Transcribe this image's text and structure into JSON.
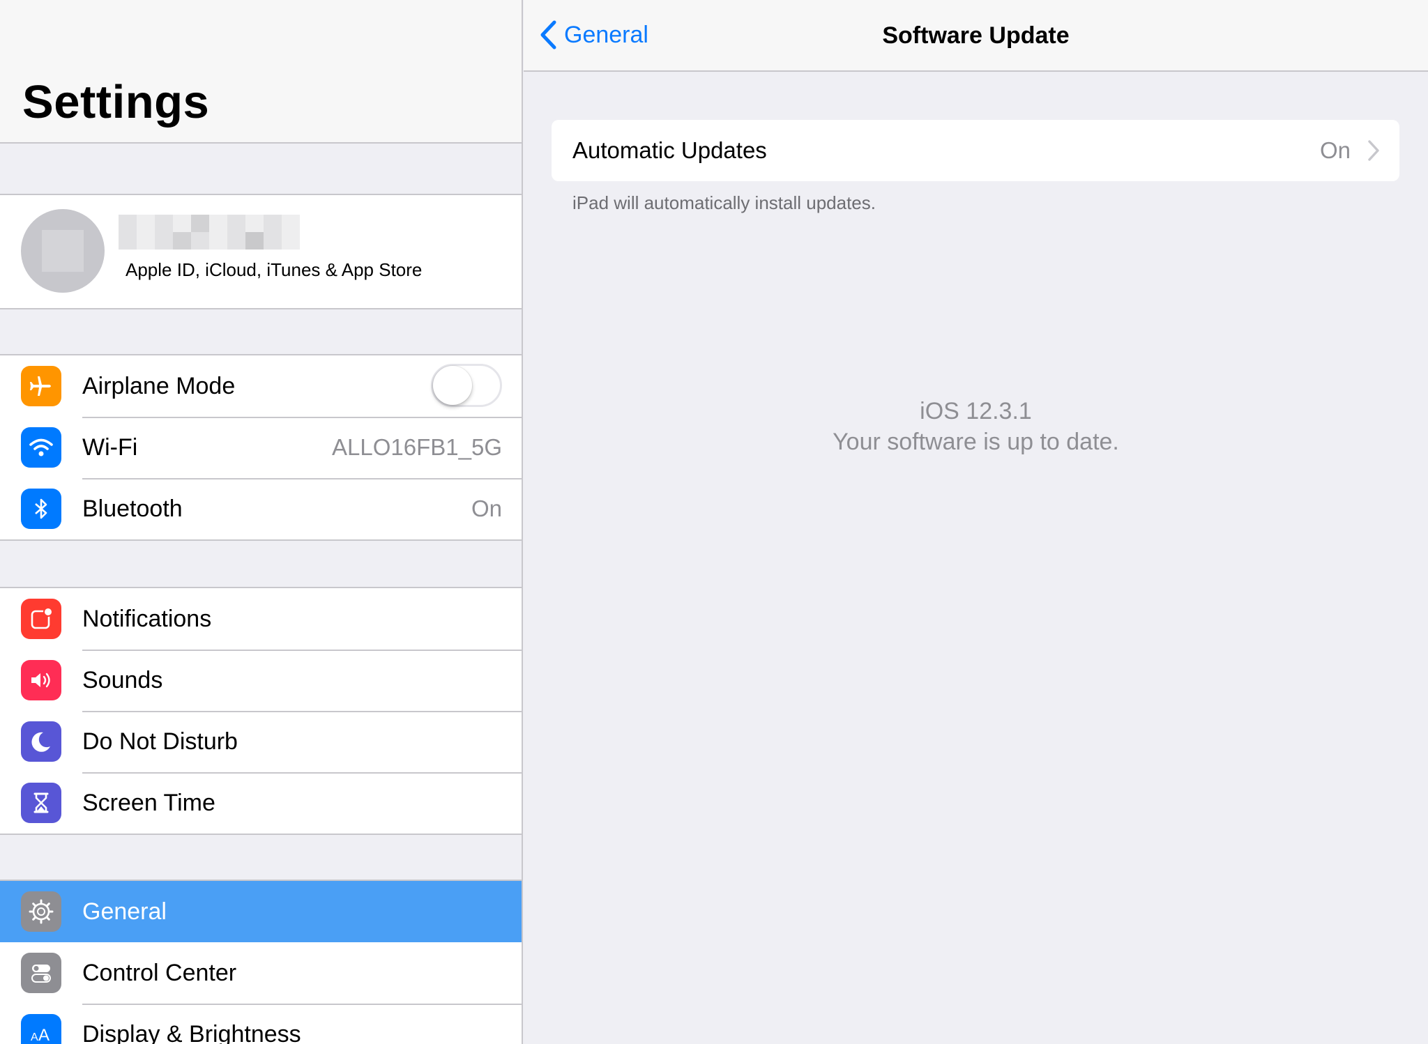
{
  "master": {
    "title": "Settings",
    "profile": {
      "subtitle": "Apple ID, iCloud, iTunes & App Store"
    },
    "connectivity": [
      {
        "label": "Airplane Mode",
        "icon": "airplane-icon",
        "color": "#ff9500",
        "toggle_on": false
      },
      {
        "label": "Wi-Fi",
        "icon": "wifi-icon",
        "color": "#007aff",
        "value": "ALLO16FB1_5G"
      },
      {
        "label": "Bluetooth",
        "icon": "bluetooth-icon",
        "color": "#007aff",
        "value": "On"
      }
    ],
    "alerts": [
      {
        "label": "Notifications",
        "icon": "notifications-icon",
        "color": "#ff3b30"
      },
      {
        "label": "Sounds",
        "icon": "sounds-icon",
        "color": "#ff2d55"
      },
      {
        "label": "Do Not Disturb",
        "icon": "moon-icon",
        "color": "#5856d6"
      },
      {
        "label": "Screen Time",
        "icon": "hourglass-icon",
        "color": "#5856d6"
      }
    ],
    "system": [
      {
        "label": "General",
        "icon": "gear-icon",
        "color": "#8e8e93",
        "selected": true
      },
      {
        "label": "Control Center",
        "icon": "control-center-icon",
        "color": "#8e8e93"
      },
      {
        "label": "Display & Brightness",
        "icon": "display-brightness-icon",
        "color": "#007aff"
      }
    ]
  },
  "detail": {
    "back_label": "General",
    "title": "Software Update",
    "automatic_updates": {
      "label": "Automatic Updates",
      "value": "On",
      "footer": "iPad will automatically install updates."
    },
    "status": {
      "version": "iOS 12.3.1",
      "message": "Your software is up to date."
    }
  },
  "colors": {
    "accent": "#0a7aff",
    "selection": "#4a9ff5",
    "background": "#efeff4"
  }
}
